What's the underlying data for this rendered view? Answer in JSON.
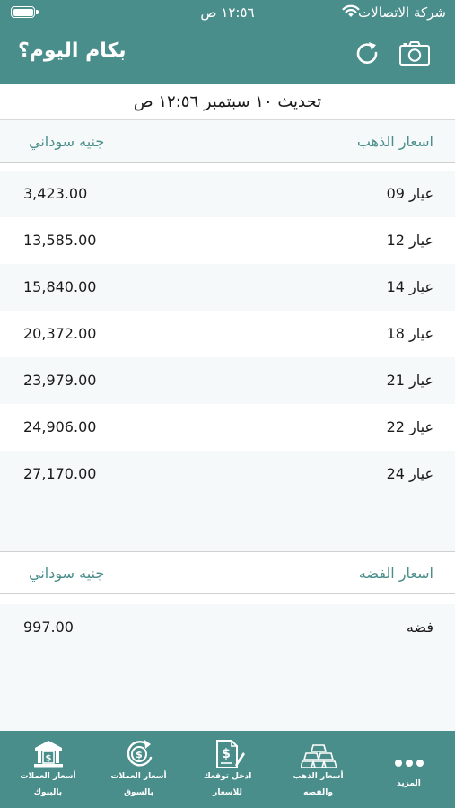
{
  "status_bar": {
    "time": "١٢:٥٦ ص",
    "carrier": "شركة الاتصالات"
  },
  "header": {
    "title": "بكام اليوم؟",
    "refresh_icon": "refresh-icon",
    "camera_icon": "camera-icon"
  },
  "update_text": "تحديث ١٠ سبتمبر ١٢:٥٦ ص",
  "gold": {
    "header_label": "اسعار الذهب",
    "header_currency": "جنيه سوداني",
    "rows": [
      {
        "label": "عيار 09",
        "value": "3,423.00"
      },
      {
        "label": "عيار 12",
        "value": "13,585.00"
      },
      {
        "label": "عيار 14",
        "value": "15,840.00"
      },
      {
        "label": "عيار 18",
        "value": "20,372.00"
      },
      {
        "label": "عيار 21",
        "value": "23,979.00"
      },
      {
        "label": "عيار 22",
        "value": "24,906.00"
      },
      {
        "label": "عيار 24",
        "value": "27,170.00"
      }
    ]
  },
  "silver": {
    "header_label": "اسعار الفضه",
    "header_currency": "جنيه سوداني",
    "rows": [
      {
        "label": "فضه",
        "value": "997.00"
      }
    ]
  },
  "tabs": [
    {
      "icon": "bank-icon",
      "line1": "أسعار العملات",
      "line2": "بالبنوك"
    },
    {
      "icon": "currency-exchange-icon",
      "line1": "أسعار العملات",
      "line2": "بالسوق"
    },
    {
      "icon": "document-dollar-icon",
      "line1": "ادخل توقعك",
      "line2": "للاسعار"
    },
    {
      "icon": "gold-bars-icon",
      "line1": "أسعار الذهب",
      "line2": "والفضه"
    },
    {
      "icon": "more-icon",
      "line1": "المزيد"
    }
  ],
  "colors": {
    "brand": "#4a8e8c",
    "row_alt": "#f6f9f9"
  }
}
